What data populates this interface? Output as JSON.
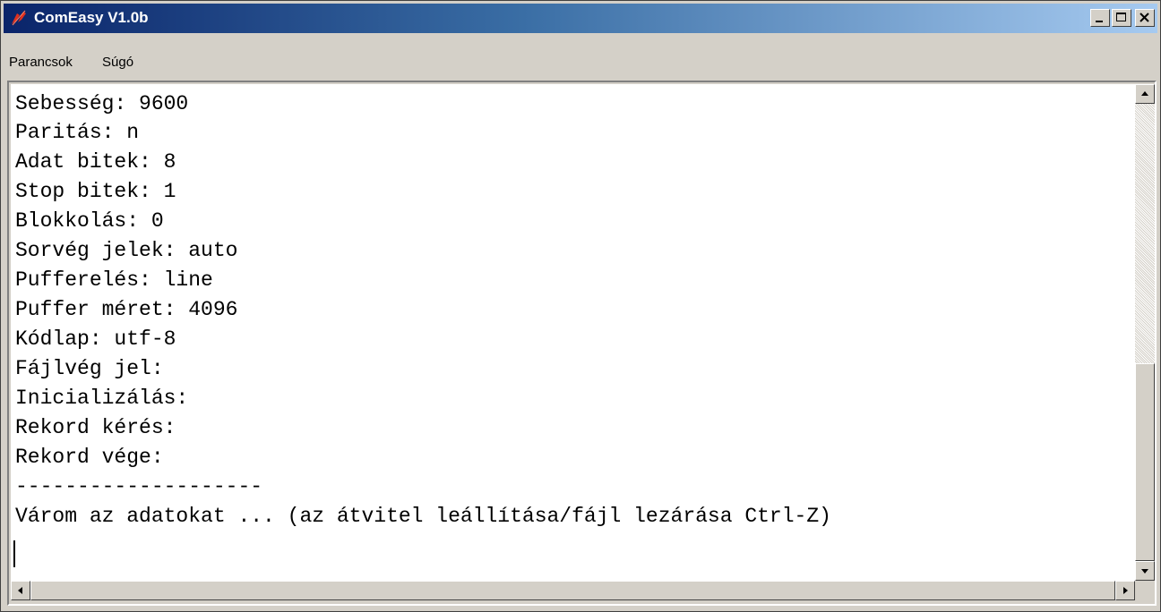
{
  "window": {
    "title": "ComEasy V1.0b",
    "app_icon": "tk-feather-icon",
    "controls": [
      "minimize-icon",
      "maximize-icon",
      "close-icon"
    ]
  },
  "menu": {
    "items": [
      {
        "label": "Parancsok"
      },
      {
        "label": "Súgó"
      }
    ]
  },
  "console": {
    "lines": [
      "Sebesség: 9600",
      "Paritás: n",
      "Adat bitek: 8",
      "Stop bitek: 1",
      "Blokkolás: 0",
      "Sorvég jelek: auto",
      "Pufferelés: line",
      "Puffer méret: 4096",
      "Kódlap: utf-8",
      "Fájlvég jel:",
      "Inicializálás:",
      "Rekord kérés:",
      "Rekord vége:",
      "--------------------",
      "Várom az adatokat ... (az átvitel leállítása/fájl lezárása Ctrl-Z)"
    ]
  },
  "colors": {
    "titlebar_start": "#0a246a",
    "titlebar_end": "#a6caf0",
    "face": "#d4d0c8",
    "console_bg": "#ffffff"
  }
}
